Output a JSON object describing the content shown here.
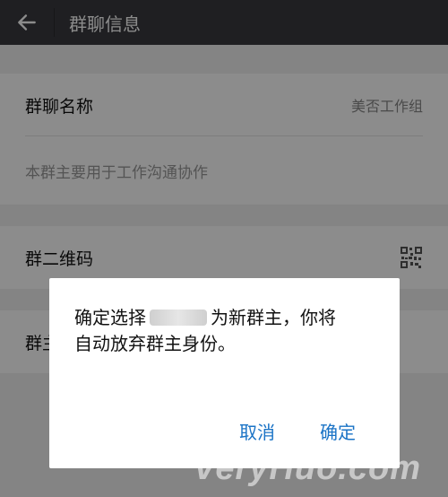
{
  "header": {
    "title": "群聊信息"
  },
  "group_info": {
    "name_label": "群聊名称",
    "name_value": "美否工作组",
    "description": "本群主要用于工作沟通协作",
    "qr_label": "群二维码",
    "partial_row_label": "群主"
  },
  "dialog": {
    "message_prefix": "确定选择",
    "message_suffix": "为新群主，你将",
    "message_line2": "自动放弃群主身份。",
    "cancel_label": "取消",
    "confirm_label": "确定"
  },
  "watermark": "VeryHuo.com"
}
